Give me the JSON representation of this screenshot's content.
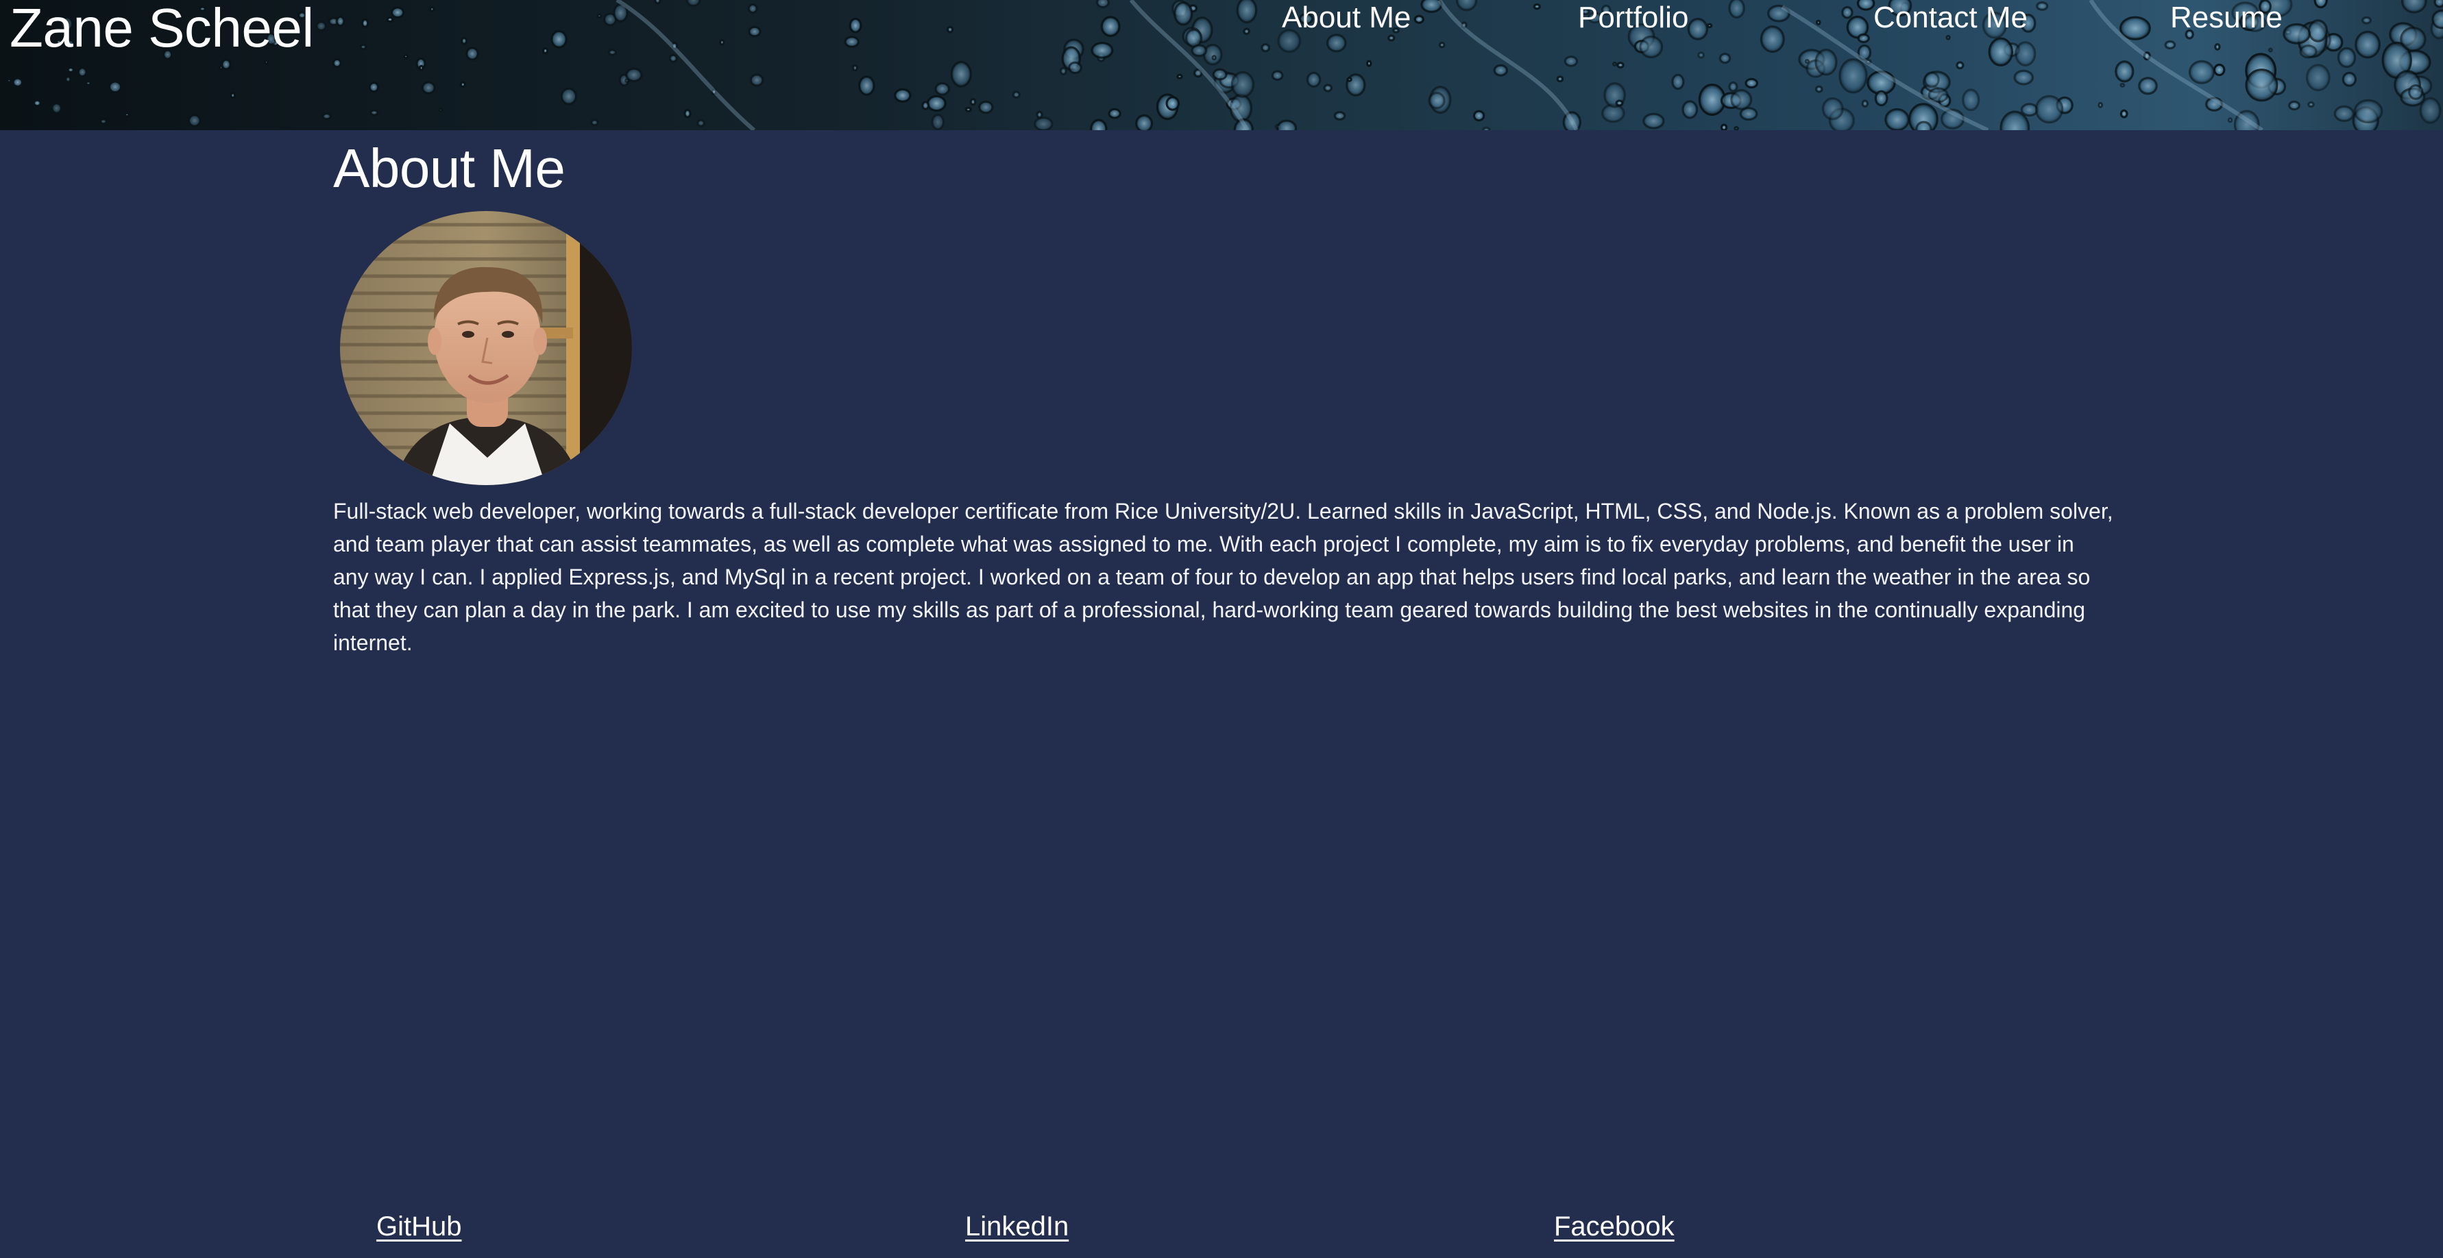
{
  "header": {
    "site_title": "Zane Scheel",
    "nav": [
      {
        "label": "About Me"
      },
      {
        "label": "Portfolio"
      },
      {
        "label": "Contact Me"
      },
      {
        "label": "Resume"
      }
    ]
  },
  "about": {
    "heading": "About Me",
    "bio": "Full-stack web developer, working towards a full-stack developer certificate from Rice University/2U. Learned skills in JavaScript, HTML, CSS, and Node.js. Known as a problem solver, and team player that can assist teammates, as well as complete what was assigned to me. With each project I complete, my aim is to fix everyday problems, and benefit the user in any way I can. I applied Express.js, and MySql in a recent project. I worked on a team of four to develop an app that helps users find local parks, and learn the weather in the area so that they can plan a day in the park. I am excited to use my skills as part of a professional, hard-working team geared towards building the best websites in the continually expanding internet."
  },
  "footer": {
    "links": [
      {
        "label": "GitHub"
      },
      {
        "label": "LinkedIn"
      },
      {
        "label": "Facebook"
      }
    ]
  },
  "colors": {
    "page_background": "#232d4e",
    "text": "#f2f4f8",
    "header_texture_dark": "#0b1419",
    "header_texture_light": "#7aa6c4"
  }
}
